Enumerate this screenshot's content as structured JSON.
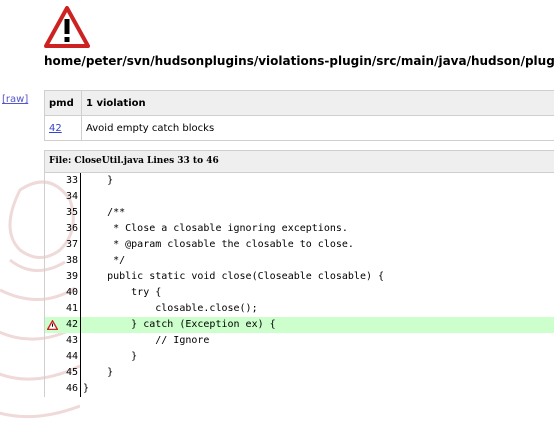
{
  "header": {
    "path": "home/peter/svn/hudsonplugins/violations-plugin/src/main/java/hudson/plugins/violations/"
  },
  "raw_link": "[raw]",
  "violations_table": {
    "headers": [
      "pmd",
      "1 violation"
    ],
    "rows": [
      {
        "line": "42",
        "message": "Avoid empty catch blocks"
      }
    ]
  },
  "file_header": "File: CloseUtil.java Lines 33 to 46",
  "code": {
    "lines": [
      {
        "num": "33",
        "text": "    }",
        "flag": false
      },
      {
        "num": "34",
        "text": "",
        "flag": false
      },
      {
        "num": "35",
        "text": "    /**",
        "flag": false
      },
      {
        "num": "36",
        "text": "     * Close a closable ignoring exceptions.",
        "flag": false
      },
      {
        "num": "37",
        "text": "     * @param closable the closable to close.",
        "flag": false
      },
      {
        "num": "38",
        "text": "     */",
        "flag": false
      },
      {
        "num": "39",
        "text": "    public static void close(Closeable closable) {",
        "flag": false
      },
      {
        "num": "40",
        "text": "        try {",
        "flag": false
      },
      {
        "num": "41",
        "text": "            closable.close();",
        "flag": false
      },
      {
        "num": "42",
        "text": "        } catch (Exception ex) {",
        "flag": true
      },
      {
        "num": "43",
        "text": "            // Ignore",
        "flag": false
      },
      {
        "num": "44",
        "text": "        }",
        "flag": false
      },
      {
        "num": "45",
        "text": "    }",
        "flag": false
      },
      {
        "num": "46",
        "text": "}",
        "flag": false
      }
    ]
  },
  "colors": {
    "highlight": "#ccffcc",
    "warning": "#cc2222",
    "link": "#3344cc"
  },
  "icons": {
    "header": "warning-icon",
    "line": "warning-icon"
  }
}
